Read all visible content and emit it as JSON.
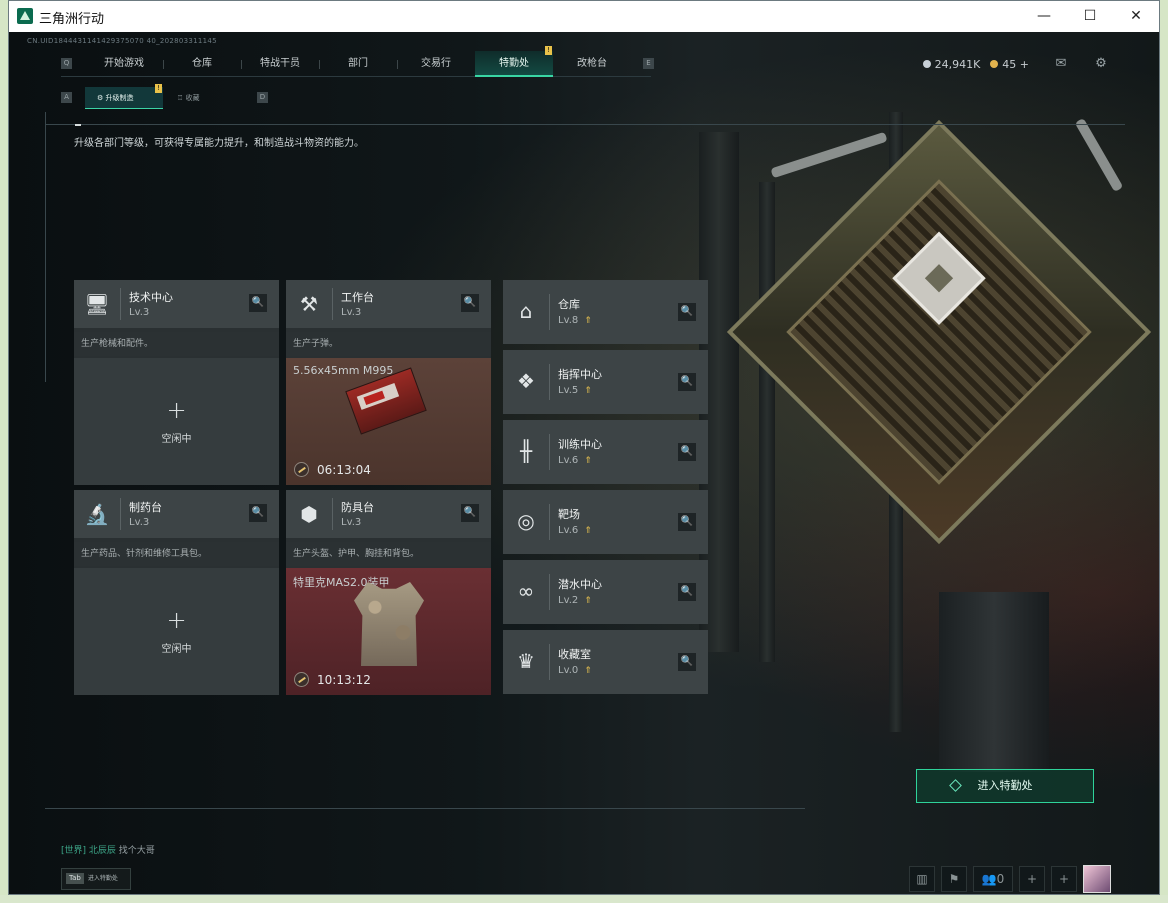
{
  "window": {
    "title": "三角洲行动",
    "min": "—",
    "max": "☐",
    "close": "✕"
  },
  "uid": "CN.UID1844431141429375070 40_202803311145",
  "nav": {
    "left_key": "Q",
    "right_key": "E",
    "tabs": [
      {
        "label": "开始游戏"
      },
      {
        "label": "仓库"
      },
      {
        "label": "特战干员"
      },
      {
        "label": "部门"
      },
      {
        "label": "交易行"
      },
      {
        "label": "特勤处",
        "active": true,
        "badge": "!"
      },
      {
        "label": "改枪台"
      }
    ]
  },
  "subnav": {
    "left_key": "A",
    "right_key": "D",
    "tabs": [
      {
        "label": "升级制造",
        "active": true,
        "badge": "!"
      },
      {
        "label": "收藏"
      }
    ]
  },
  "currency": {
    "coins": "24,941K",
    "tickets": "45",
    "add": "+",
    "coin_color": "#c7cfd6",
    "ticket_color": "#e1b24d"
  },
  "header_icons": [
    "mail-icon",
    "settings-gear-icon"
  ],
  "description": "升级各部门等级，可获得专属能力提升，和制造战斗物资的能力。",
  "workshops": [
    {
      "name": "技术中心",
      "level": "Lv.3",
      "desc": "生产枪械和配件。",
      "status": "空闲中",
      "icon": "computer-icon"
    },
    {
      "name": "工作台",
      "level": "Lv.3",
      "desc": "生产子弹。",
      "product": "5.56x45mm M995",
      "timer": "06:13:04",
      "icon": "tools-icon"
    },
    {
      "name": "制药台",
      "level": "Lv.3",
      "desc": "生产药品、针剂和维修工具包。",
      "status": "空闲中",
      "icon": "microscope-icon"
    },
    {
      "name": "防具台",
      "level": "Lv.3",
      "desc": "生产头盔、护甲、胸挂和背包。",
      "product": "特里克MAS2.0装甲",
      "timer": "10:13:12",
      "icon": "armor-blocks-icon"
    }
  ],
  "rooms": [
    {
      "name": "仓库",
      "level": "Lv.8",
      "icon": "warehouse-icon"
    },
    {
      "name": "指挥中心",
      "level": "Lv.5",
      "icon": "command-icon"
    },
    {
      "name": "训练中心",
      "level": "Lv.6",
      "icon": "dumbbell-icon"
    },
    {
      "name": "靶场",
      "level": "Lv.6",
      "icon": "target-icon"
    },
    {
      "name": "潜水中心",
      "level": "Lv.2",
      "icon": "diving-icon"
    },
    {
      "name": "收藏室",
      "level": "Lv.0",
      "icon": "collection-icon"
    }
  ],
  "enter_button": "进入特勤处",
  "chat": {
    "channel": "[世界]",
    "sender": "北辰辰",
    "message": "找个大哥"
  },
  "tab_hint": {
    "key": "Tab",
    "label": "进入特勤处"
  },
  "bottom": {
    "friends_count": "0"
  }
}
